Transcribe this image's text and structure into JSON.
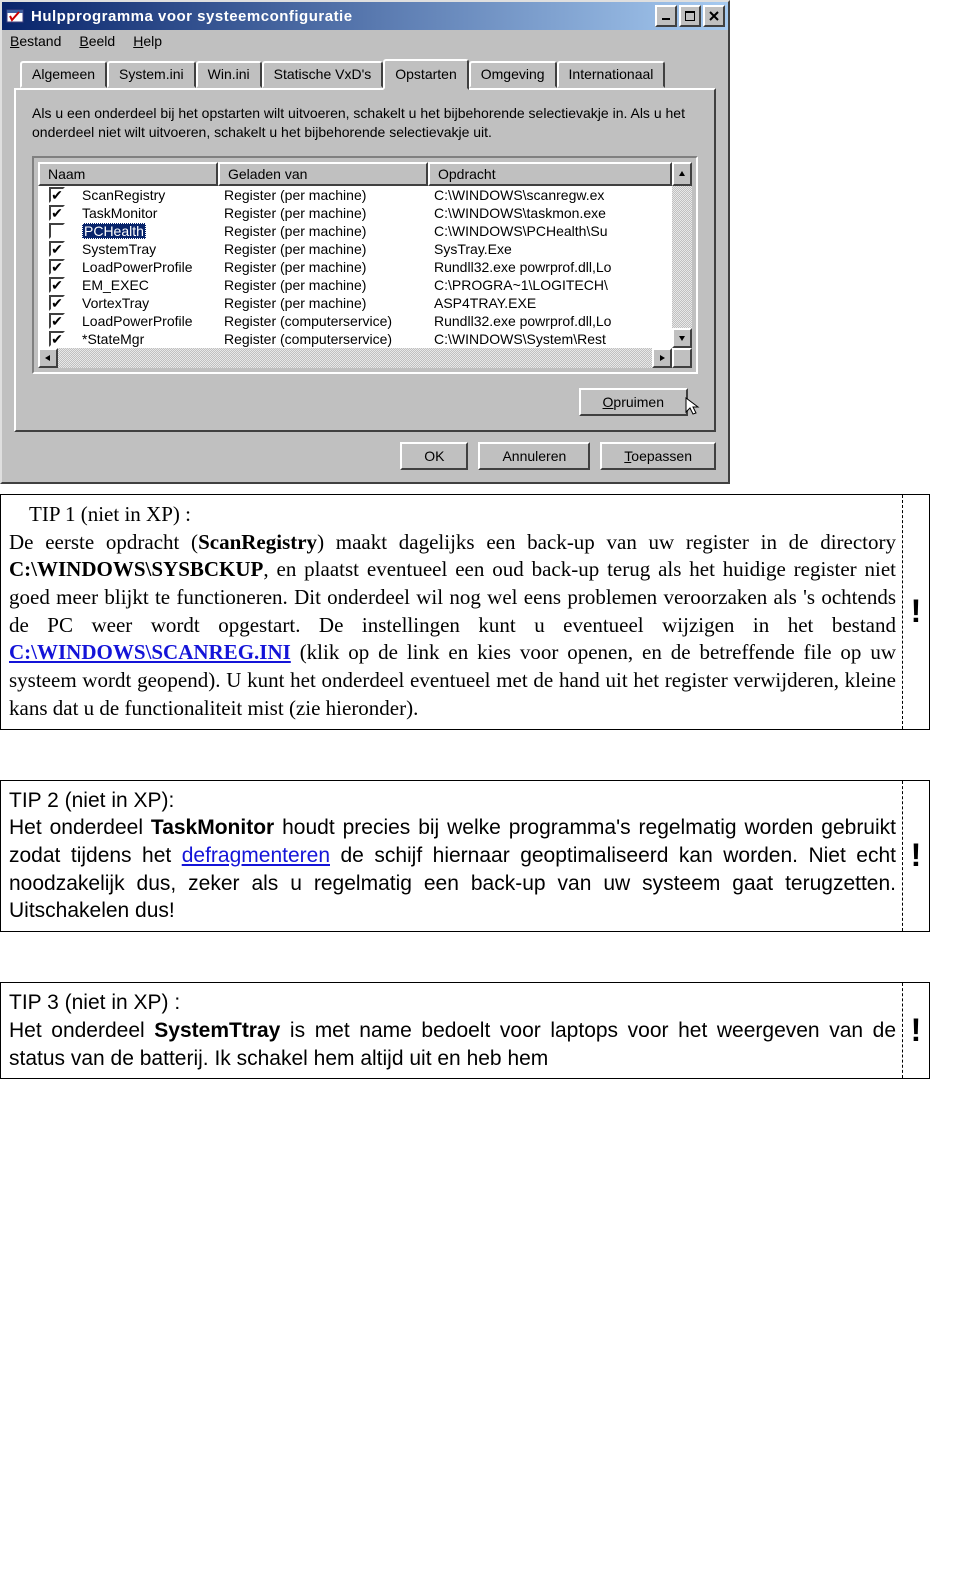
{
  "window": {
    "title": "Hulpprogramma voor systeemconfiguratie",
    "menus": [
      {
        "letter": "B",
        "rest": "estand"
      },
      {
        "letter": "B",
        "rest": "eeld"
      },
      {
        "letter": "H",
        "rest": "elp"
      }
    ],
    "tabs": [
      "Algemeen",
      "System.ini",
      "Win.ini",
      "Statische VxD's",
      "Opstarten",
      "Omgeving",
      "Internationaal"
    ],
    "activeTab": 4,
    "infoText": "Als u een onderdeel bij het opstarten wilt uitvoeren, schakelt u het bijbehorende selectievakje in. Als u het onderdeel niet wilt uitvoeren, schakelt u het bijbehorende selectievakje uit.",
    "columns": {
      "name": "Naam",
      "loaded": "Geladen van",
      "cmd": "Opdracht"
    },
    "items": [
      {
        "checked": true,
        "selected": false,
        "name": "ScanRegistry",
        "loaded": "Register (per machine)",
        "cmd": "C:\\WINDOWS\\scanregw.ex"
      },
      {
        "checked": true,
        "selected": false,
        "name": "TaskMonitor",
        "loaded": "Register (per machine)",
        "cmd": "C:\\WINDOWS\\taskmon.exe"
      },
      {
        "checked": false,
        "selected": true,
        "name": "PCHealth",
        "loaded": "Register (per machine)",
        "cmd": "C:\\WINDOWS\\PCHealth\\Su"
      },
      {
        "checked": true,
        "selected": false,
        "name": "SystemTray",
        "loaded": "Register (per machine)",
        "cmd": "SysTray.Exe"
      },
      {
        "checked": true,
        "selected": false,
        "name": "LoadPowerProfile",
        "loaded": "Register (per machine)",
        "cmd": "Rundll32.exe powrprof.dll,Lo"
      },
      {
        "checked": true,
        "selected": false,
        "name": "EM_EXEC",
        "loaded": "Register (per machine)",
        "cmd": "C:\\PROGRA~1\\LOGITECH\\"
      },
      {
        "checked": true,
        "selected": false,
        "name": "VortexTray",
        "loaded": "Register (per machine)",
        "cmd": "ASP4TRAY.EXE"
      },
      {
        "checked": true,
        "selected": false,
        "name": "LoadPowerProfile",
        "loaded": "Register (computerservice)",
        "cmd": "Rundll32.exe powrprof.dll,Lo"
      },
      {
        "checked": true,
        "selected": false,
        "name": "*StateMgr",
        "loaded": "Register (computerservice)",
        "cmd": "C:\\WINDOWS\\System\\Rest"
      }
    ],
    "buttons": {
      "clean_u": "O",
      "clean_rest": "pruimen",
      "ok": "OK",
      "cancel": "Annuleren",
      "apply_u": "T",
      "apply_rest": "oepassen"
    }
  },
  "tip1": {
    "title": "TIP 1 (niet in XP) :",
    "p1a": "De eerste opdracht (",
    "bold1": "ScanRegistry",
    "p1b": ") maakt dagelijks een back-up van uw register in de directory ",
    "bold2": "C:\\WINDOWS\\SYSBCKUP",
    "p1c": ", en plaatst eventueel een oud back-up terug als het huidige register niet goed meer blijkt te functioneren. Dit onderdeel wil nog wel eens problemen veroorzaken als 's ochtends de PC weer wordt opgestart. De instellingen kunt u eventueel wijzigen in het bestand ",
    "link": "C:\\WINDOWS\\SCANREG.INI",
    "p1d": " (klik op de link en kies voor openen, en de betreffende file op uw systeem wordt geopend). U kunt het onderdeel eventueel met de hand uit het register verwijderen, kleine kans dat u de functionaliteit mist (zie hieronder).",
    "excl": "!"
  },
  "tip2": {
    "title": "TIP 2 (niet in XP):",
    "p1a": "Het onderdeel ",
    "bold1": "TaskMonitor",
    "p1b": " houdt precies bij welke programma's regelmatig worden gebruikt zodat tijdens het ",
    "link": "defragmenteren",
    "p1c": " de schijf hiernaar geoptimaliseerd kan worden. Niet echt noodzakelijk dus, zeker als u regelmatig een back-up van uw systeem gaat terugzetten. Uitschakelen dus!",
    "excl": "!"
  },
  "tip3": {
    "title": "TIP 3 (niet in XP) :",
    "p1a": "Het onderdeel ",
    "bold1": "SystemTtray",
    "p1b": " is met name bedoelt voor laptops voor het weergeven van de status van de batterij. Ik schakel hem altijd uit en heb hem",
    "excl": "!"
  }
}
